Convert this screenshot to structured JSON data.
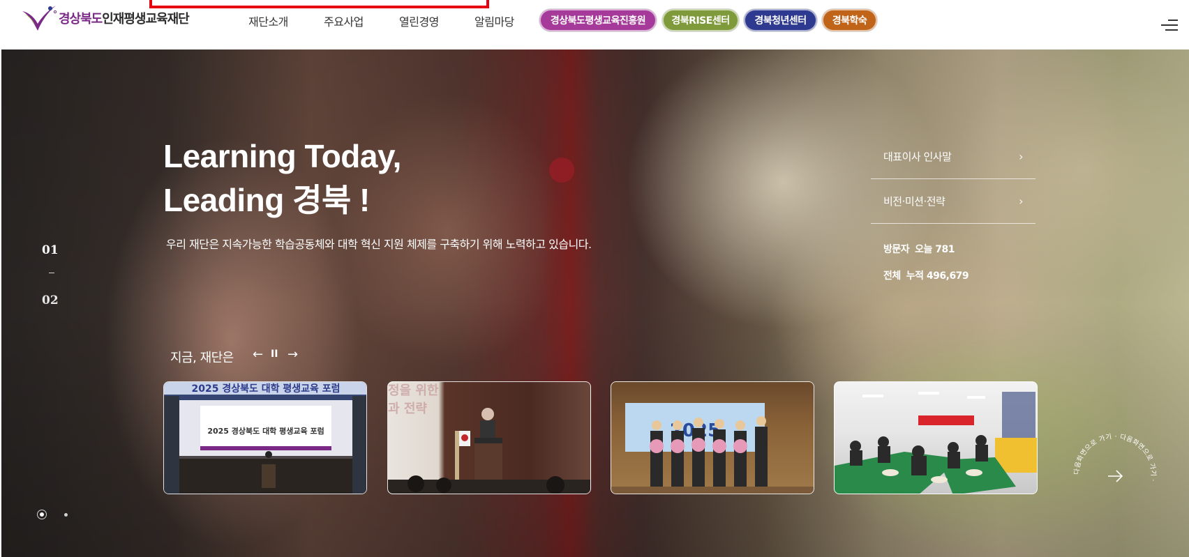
{
  "header": {
    "logo": {
      "part1": "경상북도",
      "part2": "인재평생교육재단"
    },
    "nav": [
      "재단소개",
      "주요사업",
      "열린경영",
      "알림마당"
    ],
    "pills": [
      {
        "label": "경상북도평생교육진흥원",
        "color": "#a63a9a"
      },
      {
        "label": "경북RISE센터",
        "color": "#7f9a3a"
      },
      {
        "label": "경북청년센터",
        "color": "#2d3a8f"
      },
      {
        "label": "경북학숙",
        "color": "#c0641a"
      }
    ],
    "menu_icon": "hamburger-menu-icon"
  },
  "hero": {
    "headline_line1": "Learning Today,",
    "headline_line2": "Leading 경북 !",
    "subtitle": "우리 재단은 지속가능한 학습공동체와 대학 혁신 지원 체제를 구축하기 위해 노력하고 있습니다.",
    "slide_numbers": [
      "01",
      "02"
    ],
    "side_links": [
      "대표이사 인사말",
      "비전·미션·전략"
    ],
    "visitors": {
      "today_label": "방문자",
      "today_value": "오늘 781",
      "total_label": "전체",
      "total_value": "누적 496,679"
    },
    "now_label": "지금, 재단은",
    "controls": {
      "prev": "←",
      "pause": "II",
      "next": "→"
    },
    "thumbnails": [
      {
        "screen_title": "2025 경상북도 대학 평생교육 포럼",
        "banner": "2025 경상북도 대학 평생교육 포럼"
      },
      {
        "bg_text_1": "정을 위한",
        "bg_text_2": "과 전략"
      },
      {
        "banner": "2025"
      },
      {}
    ],
    "pagination_dots": 2,
    "next_circle_text": "다음화면으로 가기 · 다음화면으로 가기 · "
  },
  "colors": {
    "accent_purple": "#7a2a86",
    "highlight_red": "#e50012"
  }
}
